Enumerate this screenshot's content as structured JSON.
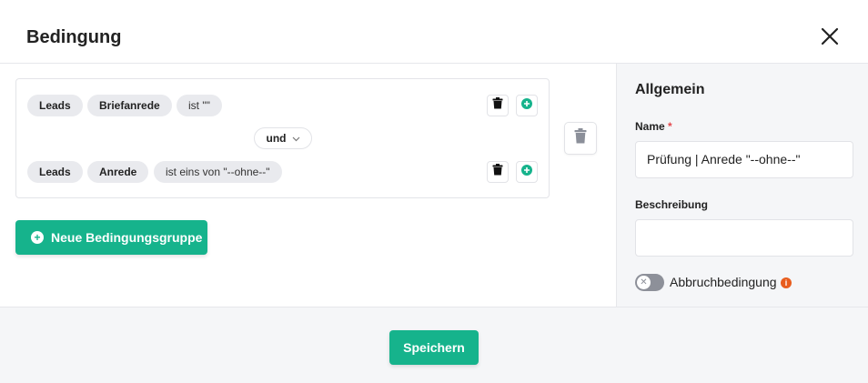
{
  "dialog": {
    "title": "Bedingung",
    "close_icon": "close-icon"
  },
  "conditions": [
    {
      "entity": "Leads",
      "field": "Briefanrede",
      "operator_value": "ist \"\""
    },
    {
      "entity": "Leads",
      "field": "Anrede",
      "operator_value": "ist eins von \"--ohne--\""
    }
  ],
  "connector": {
    "label": "und",
    "icon": "chevron-down-icon"
  },
  "actions": {
    "new_group_label": "Neue Bedingungsgruppe",
    "save_label": "Speichern"
  },
  "sidebar": {
    "heading": "Allgemein",
    "name_label": "Name",
    "name_required_marker": "*",
    "name_value": "Prüfung | Anrede \"--ohne--\"",
    "description_label": "Beschreibung",
    "description_value": "",
    "abort_label": "Abbruchbedingung",
    "abort_enabled": false
  },
  "colors": {
    "accent": "#16b38c",
    "required": "#e5484d",
    "info": "#e85d1e",
    "panel_bg": "#f5f6f8"
  }
}
